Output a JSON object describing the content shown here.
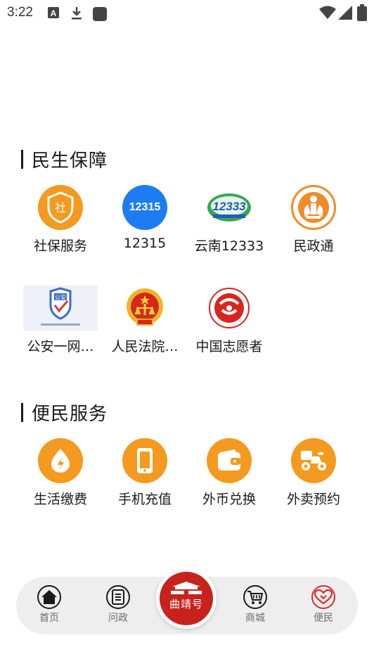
{
  "status_bar": {
    "time": "3:22"
  },
  "sections": {
    "livelihood": {
      "title": "民生保障",
      "items": [
        {
          "label": "社保服务",
          "icon": "social-security-icon",
          "glyph": "社"
        },
        {
          "label": "12315",
          "icon": "consumer-hotline-icon",
          "glyph": "12315"
        },
        {
          "label": "云南12333",
          "icon": "yunnan-12333-icon",
          "glyph": "12333"
        },
        {
          "label": "民政通",
          "icon": "civil-affairs-icon"
        },
        {
          "label": "公安一网…",
          "icon": "police-service-icon",
          "glyph": "公安"
        },
        {
          "label": "人民法院…",
          "icon": "court-emblem-icon"
        },
        {
          "label": "中国志愿者",
          "icon": "volunteer-logo-icon"
        }
      ]
    },
    "convenience": {
      "title": "便民服务",
      "items": [
        {
          "label": "生活缴费",
          "icon": "utility-payment-icon"
        },
        {
          "label": "手机充值",
          "icon": "phone-recharge-icon"
        },
        {
          "label": "外币兑换",
          "icon": "currency-exchange-icon"
        },
        {
          "label": "外卖预约",
          "icon": "food-delivery-icon"
        }
      ]
    }
  },
  "bottom_nav": {
    "items": [
      {
        "label": "首页",
        "icon": "home-icon"
      },
      {
        "label": "问政",
        "icon": "document-icon"
      },
      {
        "label": "曲靖号",
        "icon": "city-gate-icon"
      },
      {
        "label": "商城",
        "icon": "cart-icon"
      },
      {
        "label": "便民",
        "icon": "heart-icon"
      }
    ],
    "active": "便民"
  },
  "colors": {
    "accent_orange": "#f39a1f",
    "blue": "#1e7cf2",
    "brand_red": "#c8221d",
    "active_red": "#d72c2c"
  }
}
